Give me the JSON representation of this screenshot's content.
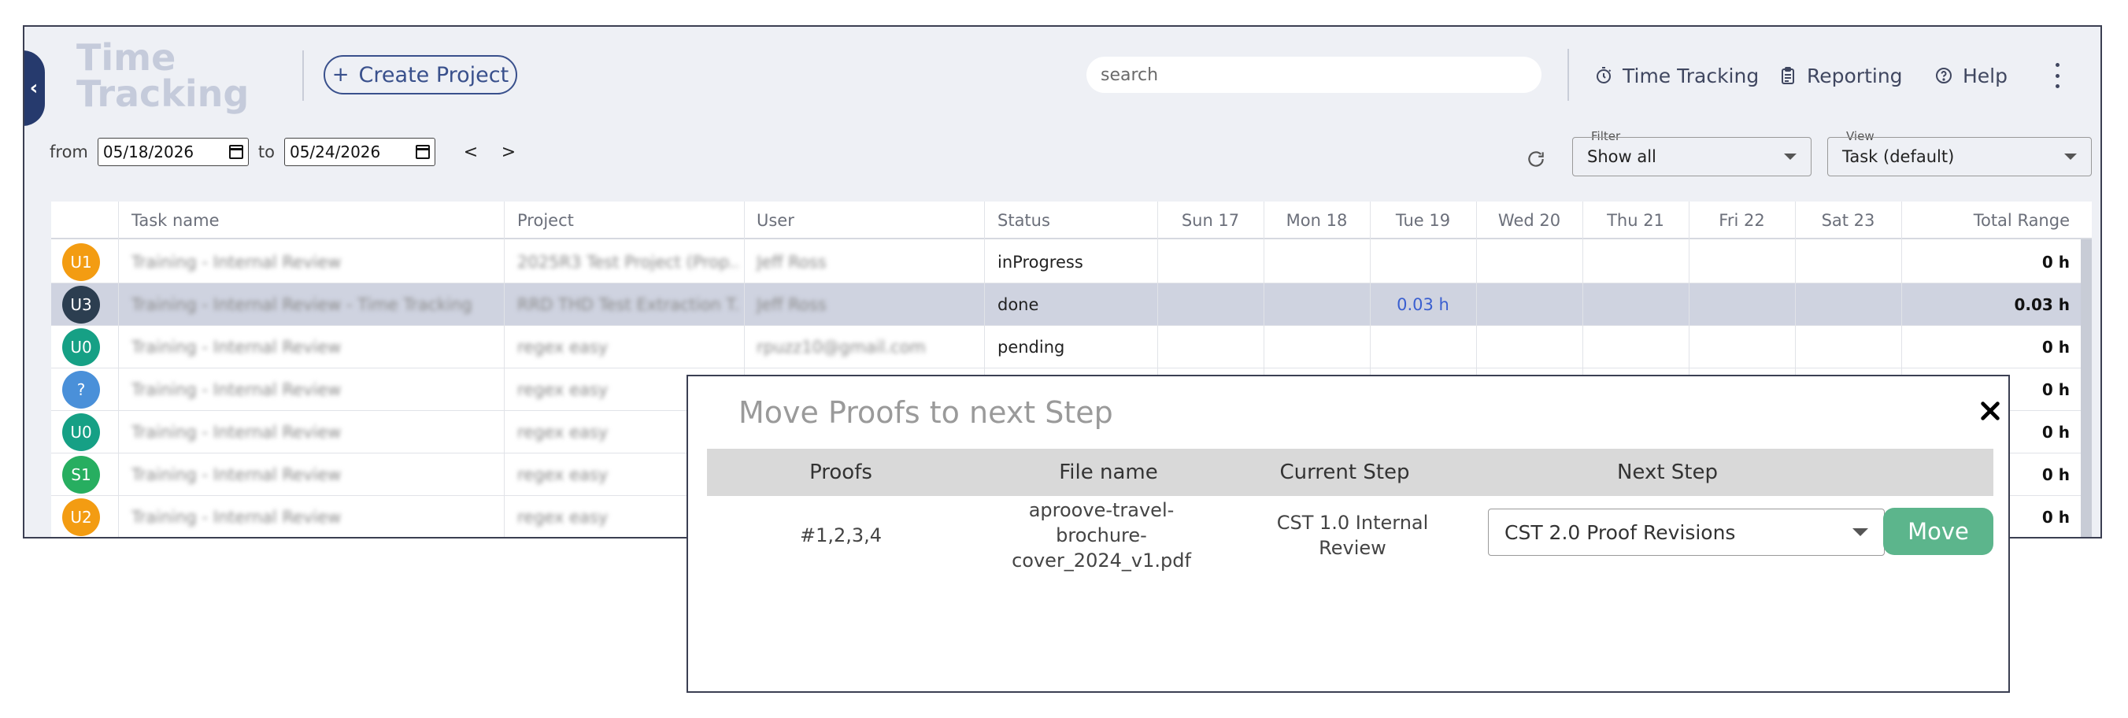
{
  "app": {
    "title_line1": "Time",
    "title_line2": "Tracking",
    "create_project": "Create Project",
    "search_placeholder": "search"
  },
  "nav": {
    "time_tracking": "Time Tracking",
    "reporting": "Reporting",
    "help": "Help"
  },
  "dates": {
    "from_label": "from",
    "from_value": "05/18/2026",
    "to_label": "to",
    "to_value": "05/24/2026",
    "prev": "<",
    "next": ">"
  },
  "filter": {
    "label": "Filter",
    "value": "Show all"
  },
  "view": {
    "label": "View",
    "value": "Task (default)"
  },
  "grid": {
    "columns": [
      "Task name",
      "Project",
      "User",
      "Status",
      "Sun 17",
      "Mon 18",
      "Tue 19",
      "Wed 20",
      "Thu 21",
      "Fri 22",
      "Sat 23",
      "Total Range"
    ],
    "rows": [
      {
        "avatar": "U1",
        "avatar_color": "#f39c12",
        "task": "Training - Internal Review",
        "project": "2025R3 Test Project (Prop...",
        "user": "Jeff Ross",
        "status": "inProgress",
        "tue": "",
        "total": "0 h"
      },
      {
        "avatar": "U3",
        "avatar_color": "#2c3e50",
        "task": "Training - Internal Review - Time Tracking",
        "project": "RRD THD Test Extraction T...",
        "user": "Jeff Ross",
        "status": "done",
        "tue": "0.03 h",
        "total": "0.03 h"
      },
      {
        "avatar": "U0",
        "avatar_color": "#16a085",
        "task": "Training - Internal Review",
        "project": "regex easy",
        "user": "rpuzz10@gmail.com",
        "status": "pending",
        "tue": "",
        "total": "0 h"
      },
      {
        "avatar": "?",
        "avatar_color": "#4a90d9",
        "task": "Training - Internal Review",
        "project": "regex easy",
        "user": "",
        "status": "",
        "tue": "",
        "total": "0 h"
      },
      {
        "avatar": "U0",
        "avatar_color": "#16a085",
        "task": "Training - Internal Review",
        "project": "regex easy",
        "user": "",
        "status": "",
        "tue": "",
        "total": "0 h"
      },
      {
        "avatar": "S1",
        "avatar_color": "#27ae60",
        "task": "Training - Internal Review",
        "project": "regex easy",
        "user": "",
        "status": "",
        "tue": "",
        "total": "0 h"
      },
      {
        "avatar": "U2",
        "avatar_color": "#f39c12",
        "task": "Training - Internal Review",
        "project": "regex easy",
        "user": "",
        "status": "",
        "tue": "",
        "total": "0 h"
      }
    ]
  },
  "modal": {
    "title": "Move Proofs to next Step",
    "headers": {
      "proofs": "Proofs",
      "file_name": "File name",
      "current_step": "Current Step",
      "next_step": "Next Step"
    },
    "row": {
      "proofs": "#1,2,3,4",
      "file_name": "aproove-travel-brochure-cover_2024_v1.pdf",
      "current_step": "CST 1.0 Internal Review",
      "next_step": "CST 2.0 Proof Revisions"
    },
    "move_label": "Move"
  }
}
